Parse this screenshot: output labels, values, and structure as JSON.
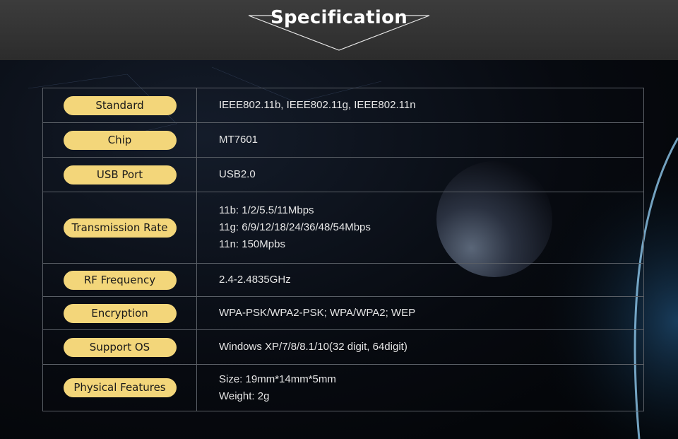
{
  "header": {
    "title": "Specification"
  },
  "specs": [
    {
      "label": "Standard",
      "values": [
        "IEEE802.11b, IEEE802.11g, IEEE802.11n"
      ]
    },
    {
      "label": "Chip",
      "values": [
        "MT7601"
      ]
    },
    {
      "label": "USB Port",
      "values": [
        "USB2.0"
      ]
    },
    {
      "label": "Transmission Rate",
      "values": [
        "11b: 1/2/5.5/11Mbps",
        "11g: 6/9/12/18/24/36/48/54Mbps",
        "11n: 150Mpbs"
      ]
    },
    {
      "label": "RF Frequency",
      "values": [
        "2.4-2.4835GHz"
      ]
    },
    {
      "label": "Encryption",
      "values": [
        "WPA-PSK/WPA2-PSK; WPA/WPA2; WEP"
      ]
    },
    {
      "label": "Support OS",
      "values": [
        "Windows XP/7/8/8.1/10(32 digit, 64digit)"
      ]
    },
    {
      "label": "Physical Features",
      "values": [
        "Size: 19mm*14mm*5mm",
        "Weight: 2g"
      ]
    }
  ],
  "colors": {
    "pill": "#f3d67a",
    "border": "#5a5f66",
    "header": "#333333"
  }
}
